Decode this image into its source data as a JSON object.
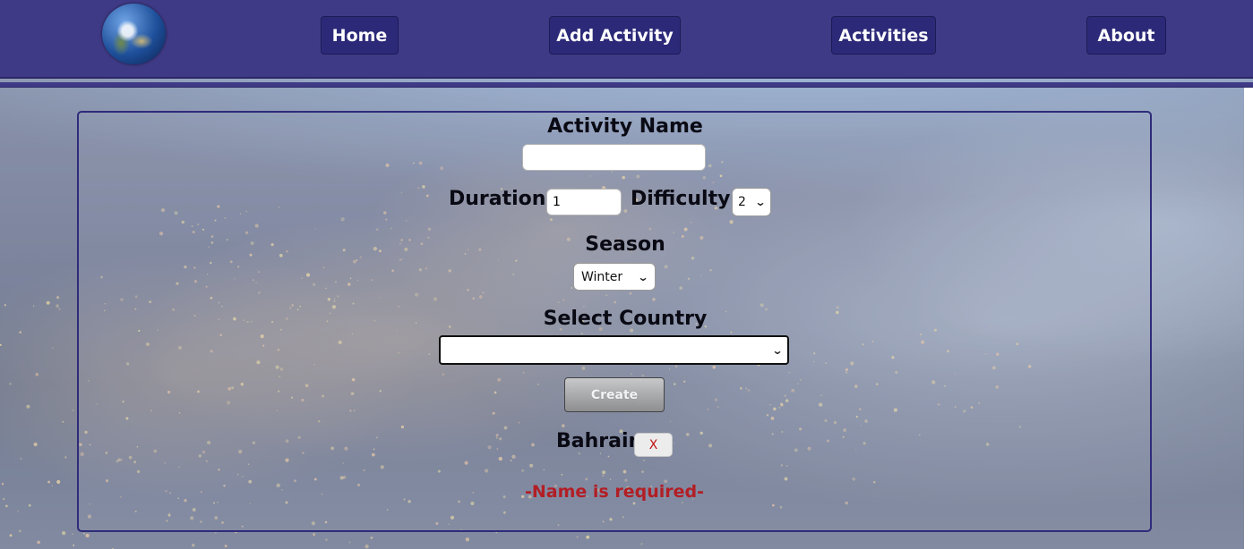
{
  "nav": {
    "home": "Home",
    "add_activity": "Add Activity",
    "activities": "Activities",
    "about": "About"
  },
  "form": {
    "name_label": "Activity Name",
    "name_value": "",
    "duration_label": "Duration",
    "duration_value": "1",
    "difficulty_label": "Difficulty",
    "difficulty_value": "2",
    "season_label": "Season",
    "season_value": "Winter",
    "country_label": "Select Country",
    "country_value": "",
    "create_button": "Create",
    "selected_countries": [
      "Bahrain"
    ],
    "remove_label": "X",
    "error_message": "-Name is required-"
  },
  "colors": {
    "navbar": "#3f3a86",
    "nav_button": "#2c2a78",
    "error": "#b21e24",
    "panel_border": "#2f2b7a"
  },
  "icons": {
    "logo": "earth-globe-icon",
    "dropdown": "chevron-down-icon"
  }
}
